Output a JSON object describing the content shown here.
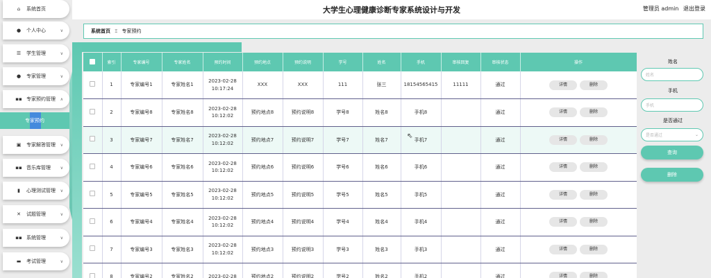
{
  "header": {
    "title": "大学生心理健康诊断专家系统设计与开发",
    "user": "管理员 admin",
    "logout": "退出登录"
  },
  "breadcrumb": {
    "home": "系统首页",
    "sep": "Ξ",
    "current": "专家预约"
  },
  "sidebar": {
    "items": [
      {
        "label": "系统首页",
        "icon": "home-icon",
        "glyph": "⌂"
      },
      {
        "label": "个人中心",
        "icon": "user-icon",
        "glyph": "●"
      },
      {
        "label": "学生管理",
        "icon": "list-icon",
        "glyph": "☰"
      },
      {
        "label": "专家管理",
        "icon": "user-icon",
        "glyph": "●"
      },
      {
        "label": "专家预约管理",
        "icon": "grid-icon",
        "glyph": "▪▪"
      },
      {
        "label": "专家解答管理",
        "icon": "calendar-icon",
        "glyph": "▣"
      },
      {
        "label": "音乐库管理",
        "icon": "grid-icon",
        "glyph": "▪▪"
      },
      {
        "label": "心理测试管理",
        "icon": "chart-icon",
        "glyph": "▮"
      },
      {
        "label": "试题管理",
        "icon": "shuffle-icon",
        "glyph": "✕"
      },
      {
        "label": "系统管理",
        "icon": "grid-icon",
        "glyph": "▪▪"
      },
      {
        "label": "考试管理",
        "icon": "exam-icon",
        "glyph": "▬"
      }
    ],
    "sub_item": "专家预约"
  },
  "table": {
    "headers": [
      "索引",
      "专家编号",
      "专家姓名",
      "预约时间",
      "预约地点",
      "预约说明",
      "学号",
      "姓名",
      "手机",
      "审核回复",
      "审核状态",
      "操作"
    ],
    "rows": [
      [
        "1",
        "专家编号1",
        "专家姓名1",
        "2023-02-28 10:17:24",
        "XXX",
        "XXX",
        "111",
        "张三",
        "18154565415",
        "11111",
        "通过"
      ],
      [
        "2",
        "专家编号8",
        "专家姓名8",
        "2023-02-28 10:12:02",
        "预约地点8",
        "预约说明8",
        "学号8",
        "姓名8",
        "手机8",
        "",
        "通过"
      ],
      [
        "3",
        "专家编号7",
        "专家姓名7",
        "2023-02-28 10:12:02",
        "预约地点7",
        "预约说明7",
        "学号7",
        "姓名7",
        "手机7",
        "",
        "通过"
      ],
      [
        "4",
        "专家编号6",
        "专家姓名6",
        "2023-02-28 10:12:02",
        "预约地点6",
        "预约说明6",
        "学号6",
        "姓名6",
        "手机6",
        "",
        "通过"
      ],
      [
        "5",
        "专家编号5",
        "专家姓名5",
        "2023-02-28 10:12:02",
        "预约地点5",
        "预约说明5",
        "学号5",
        "姓名5",
        "手机5",
        "",
        "通过"
      ],
      [
        "6",
        "专家编号4",
        "专家姓名4",
        "2023-02-28 10:12:02",
        "预约地点4",
        "预约说明4",
        "学号4",
        "姓名4",
        "手机4",
        "",
        "通过"
      ],
      [
        "7",
        "专家编号3",
        "专家姓名3",
        "2023-02-28 10:12:02",
        "预约地点3",
        "预约说明3",
        "学号3",
        "姓名3",
        "手机3",
        "",
        "通过"
      ],
      [
        "8",
        "专家编号2",
        "专家姓名2",
        "2023-02-28",
        "预约地点2",
        "预约说明2",
        "学号2",
        "姓名2",
        "手机2",
        "",
        "通过"
      ]
    ],
    "detail_btn": "详情",
    "delete_btn": "删除"
  },
  "search": {
    "name_label": "姓名",
    "name_placeholder": "姓名",
    "phone_label": "手机",
    "phone_placeholder": "手机",
    "passed_label": "是否通过",
    "passed_placeholder": "是否通过",
    "query_btn": "查询",
    "delete_btn": "删除"
  },
  "colors": {
    "accent": "#5ec8b1",
    "highlight": "#3e7ae8"
  }
}
